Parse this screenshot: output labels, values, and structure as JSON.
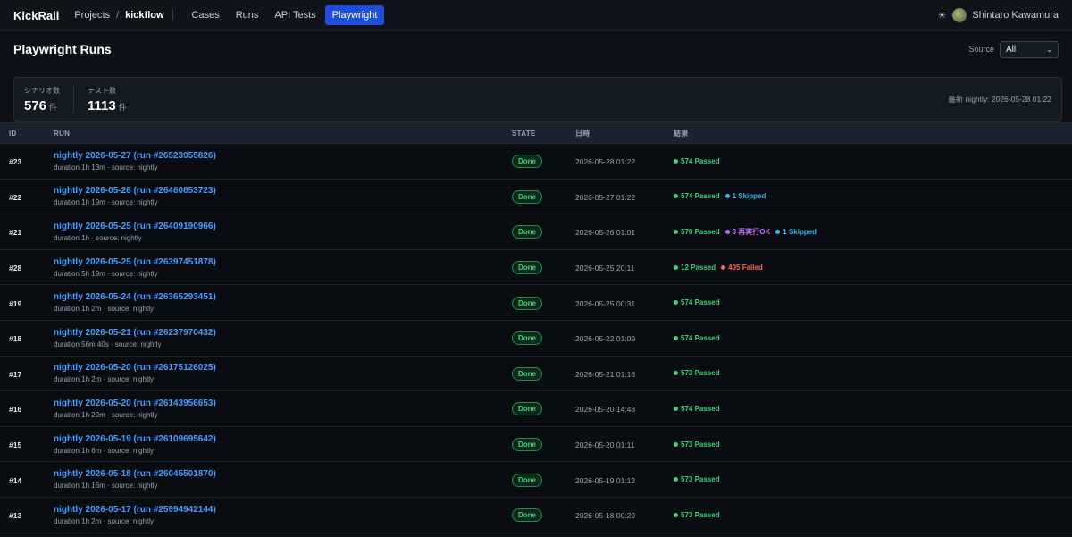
{
  "nav": {
    "brand": "KickRail",
    "projects": "Projects",
    "separator": "/",
    "project": "kickflow",
    "tabs": [
      {
        "label": "Cases",
        "active": false
      },
      {
        "label": "Runs",
        "active": false
      },
      {
        "label": "API Tests",
        "active": false
      },
      {
        "label": "Playwright",
        "active": true
      }
    ],
    "theme_icon": "☀",
    "user": "Shintaro Kawamura"
  },
  "page": {
    "title": "Playwright Runs",
    "source_label": "Source",
    "source_value": "All"
  },
  "summary": {
    "scenario_label": "シナリオ数",
    "scenario_count": "576",
    "scenario_unit": "件",
    "test_label": "テスト数",
    "test_count": "1113",
    "test_unit": "件",
    "latest": "最新 nightly: 2026-05-28 01:22"
  },
  "columns": {
    "id": "ID",
    "run": "RUN",
    "state": "STATE",
    "date": "日時",
    "result": "結果"
  },
  "rows": [
    {
      "id": "#23",
      "title": "nightly 2026-05-27 (run #26523955826)",
      "meta": "duration 1h 13m  ·  source: nightly",
      "state": "Done",
      "date": "2026-05-28 01:22",
      "results": [
        {
          "text": "574 Passed",
          "kind": "passed"
        }
      ]
    },
    {
      "id": "#22",
      "title": "nightly 2026-05-26 (run #26460853723)",
      "meta": "duration 1h 19m  ·  source: nightly",
      "state": "Done",
      "date": "2026-05-27 01:22",
      "results": [
        {
          "text": "574 Passed",
          "kind": "passed"
        },
        {
          "text": "1 Skipped",
          "kind": "skipped"
        }
      ]
    },
    {
      "id": "#21",
      "title": "nightly 2026-05-25 (run #26409190966)",
      "meta": "duration 1h  ·  source: nightly",
      "state": "Done",
      "date": "2026-05-26 01:01",
      "results": [
        {
          "text": "570 Passed",
          "kind": "passed"
        },
        {
          "text": "3 再実行OK",
          "kind": "retry"
        },
        {
          "text": "1 Skipped",
          "kind": "skipped"
        }
      ]
    },
    {
      "id": "#28",
      "title": "nightly 2026-05-25 (run #26397451878)",
      "meta": "duration 5h 19m  ·  source: nightly",
      "state": "Done",
      "date": "2026-05-25 20:11",
      "results": [
        {
          "text": "12 Passed",
          "kind": "passed"
        },
        {
          "text": "405 Failed",
          "kind": "failed"
        }
      ]
    },
    {
      "id": "#19",
      "title": "nightly 2026-05-24 (run #26365293451)",
      "meta": "duration 1h 2m  ·  source: nightly",
      "state": "Done",
      "date": "2026-05-25 00:31",
      "results": [
        {
          "text": "574 Passed",
          "kind": "passed"
        }
      ]
    },
    {
      "id": "#18",
      "title": "nightly 2026-05-21 (run #26237970432)",
      "meta": "duration 56m 40s  ·  source: nightly",
      "state": "Done",
      "date": "2026-05-22 01:09",
      "results": [
        {
          "text": "574 Passed",
          "kind": "passed"
        }
      ]
    },
    {
      "id": "#17",
      "title": "nightly 2026-05-20 (run #26175126025)",
      "meta": "duration 1h 2m  ·  source: nightly",
      "state": "Done",
      "date": "2026-05-21 01:16",
      "results": [
        {
          "text": "573 Passed",
          "kind": "passed"
        }
      ]
    },
    {
      "id": "#16",
      "title": "nightly 2026-05-20 (run #26143956653)",
      "meta": "duration 1h 29m  ·  source: nightly",
      "state": "Done",
      "date": "2026-05-20 14:48",
      "results": [
        {
          "text": "574 Passed",
          "kind": "passed"
        }
      ]
    },
    {
      "id": "#15",
      "title": "nightly 2026-05-19 (run #26109695642)",
      "meta": "duration 1h 6m  ·  source: nightly",
      "state": "Done",
      "date": "2026-05-20 01:11",
      "results": [
        {
          "text": "573 Passed",
          "kind": "passed"
        }
      ]
    },
    {
      "id": "#14",
      "title": "nightly 2026-05-18 (run #26045501870)",
      "meta": "duration 1h 16m  ·  source: nightly",
      "state": "Done",
      "date": "2026-05-19 01:12",
      "results": [
        {
          "text": "573 Passed",
          "kind": "passed"
        }
      ]
    },
    {
      "id": "#13",
      "title": "nightly 2026-05-17 (run #25994942144)",
      "meta": "duration 1h 2m  ·  source: nightly",
      "state": "Done",
      "date": "2026-05-18 00:29",
      "results": [
        {
          "text": "573 Passed",
          "kind": "passed"
        }
      ]
    }
  ]
}
